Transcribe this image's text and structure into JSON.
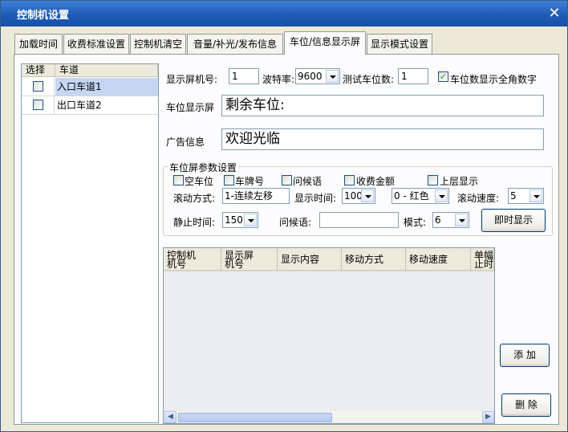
{
  "window": {
    "title": "控制机设置",
    "close_glyph": "✕"
  },
  "tabs": [
    {
      "label": "加载时间"
    },
    {
      "label": "收费标准设置"
    },
    {
      "label": "控制机清空"
    },
    {
      "label": "音量/补光/发布信息"
    },
    {
      "label": "车位/信息显示屏",
      "active": true
    },
    {
      "label": "显示模式设置"
    }
  ],
  "lane_list": {
    "headers": [
      "选择",
      "车道"
    ],
    "rows": [
      {
        "checked": false,
        "name": "入口车道1",
        "selected": true
      },
      {
        "checked": false,
        "name": "出口车道2",
        "selected": false
      }
    ]
  },
  "display": {
    "screen_no_label": "显示屏机号:",
    "screen_no_value": "1",
    "baud_label": "波特率:",
    "baud_value": "9600",
    "test_count_label": "测试车位数:",
    "test_count_value": "1",
    "fullwidth_label": "车位数显示全角数字",
    "fullwidth_checked": true,
    "fullwidth_check_glyph": "✓",
    "space_display_label": "车位显示屏",
    "space_display_value": "剩余车位:",
    "ad_label": "广告信息",
    "ad_value": "欢迎光临"
  },
  "params": {
    "group_title": "车位屏参数设置",
    "options": [
      {
        "label": "空车位",
        "checked": false
      },
      {
        "label": "车牌号",
        "checked": false
      },
      {
        "label": "问候语",
        "checked": false
      },
      {
        "label": "收费金额",
        "checked": false
      },
      {
        "label": "上层显示",
        "checked": false
      }
    ],
    "scroll_mode_label": "滚动方式:",
    "scroll_mode_value": "1-连续左移",
    "show_time_label": "显示时间:",
    "show_time_value": "100",
    "color_value": "0 - 红色",
    "scroll_speed_label": "滚动速度:",
    "scroll_speed_value": "5",
    "still_time_label": "静止时间:",
    "still_time_value": "150",
    "greeting_label": "问候语:",
    "greeting_value": "",
    "mode_label": "模式:",
    "mode_value": "6",
    "instant_button": "即时显示"
  },
  "grid": {
    "headers": [
      {
        "line1": "控制机",
        "line2": "机号"
      },
      {
        "line1": "显示屏",
        "line2": "机号"
      },
      {
        "line1": "显示内容",
        "line2": ""
      },
      {
        "line1": "移动方式",
        "line2": ""
      },
      {
        "line1": "移动速度",
        "line2": ""
      },
      {
        "line1": "单幅",
        "line2": "止时"
      }
    ],
    "scroll_left": "◀",
    "scroll_right": "▶"
  },
  "buttons": {
    "add": "添  加",
    "delete": "删  除"
  },
  "colors": {
    "titlebar": "#1f5bb6",
    "selection": "#c5d6f2",
    "dialog_bg": "#ece9d8"
  }
}
